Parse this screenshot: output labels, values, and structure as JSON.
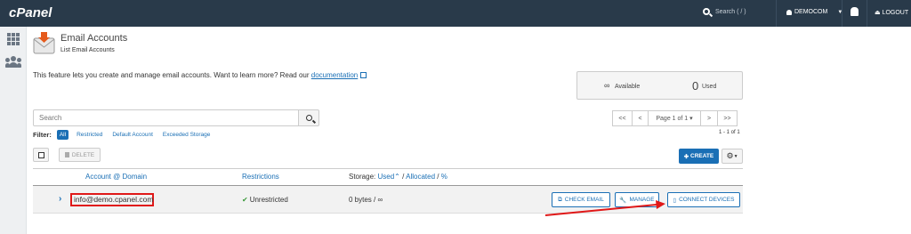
{
  "topbar": {
    "logo": "cPanel",
    "search_placeholder": "Search ( / )",
    "user": "DEMOCOM",
    "logout": "LOGOUT"
  },
  "header": {
    "title": "Email Accounts",
    "subtitle": "List Email Accounts"
  },
  "intro": {
    "text": "This feature lets you create and manage email accounts. Want to learn more? Read our ",
    "link": "documentation"
  },
  "usage": {
    "available_symbol": "∞",
    "available_label": "Available",
    "used_count": "0",
    "used_label": "Used"
  },
  "search": {
    "placeholder": "Search"
  },
  "pager": {
    "first": "<<",
    "prev": "<",
    "page": "Page 1 of 1",
    "next": ">",
    "last": ">>",
    "range": "1 - 1 of 1"
  },
  "filter": {
    "label": "Filter:",
    "options": [
      "All",
      "Restricted",
      "Default Account",
      "Exceeded Storage"
    ],
    "active": "All"
  },
  "actions": {
    "delete": "DELETE",
    "create": "CREATE"
  },
  "table": {
    "col_account": "Account @ Domain",
    "col_restrictions": "Restrictions",
    "col_storage": "Storage:",
    "col_used": "Used",
    "col_allocated": "Allocated",
    "col_percent": "%",
    "rows": [
      {
        "account": "info@demo.cpanel.com",
        "restriction": "Unrestricted",
        "storage": "0 bytes / ∞",
        "btn_check": "CHECK EMAIL",
        "btn_manage": "MANAGE",
        "btn_connect": "CONNECT DEVICES"
      }
    ]
  },
  "colors": {
    "topbar": "#293a4a",
    "accent": "#1a6fb5",
    "highlight": "#e01818"
  }
}
